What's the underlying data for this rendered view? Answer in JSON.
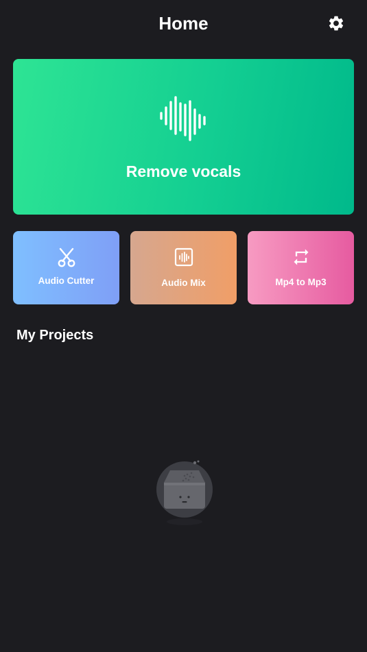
{
  "header": {
    "title": "Home",
    "settings_icon": "gear-icon"
  },
  "hero": {
    "label": "Remove vocals",
    "icon": "sound-wave-icon"
  },
  "tools": [
    {
      "label": "Audio Cutter",
      "icon": "scissors-icon"
    },
    {
      "label": "Audio Mix",
      "icon": "audio-wave-box-icon"
    },
    {
      "label": "Mp4 to Mp3",
      "icon": "repeat-arrows-icon"
    }
  ],
  "projects": {
    "title": "My Projects",
    "empty_icon": "empty-inbox-icon"
  },
  "colors": {
    "background": "#1c1c20",
    "hero_start": "#2ee494",
    "hero_end": "#00b98b",
    "cutter_start": "#7fbfff",
    "cutter_end": "#7f9ff6",
    "mix_start": "#d6a78f",
    "mix_end": "#f09e67",
    "mp4_start": "#f79bc2",
    "mp4_end": "#e65ba0"
  }
}
